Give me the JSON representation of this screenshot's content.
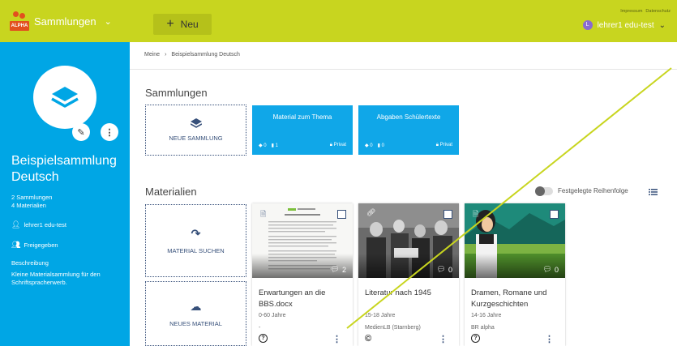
{
  "app": {
    "logo_text": "ALPHA",
    "title": "Sammlungen",
    "new_button": "Neu",
    "links": [
      "Impressum",
      "Datenschutz"
    ],
    "user_name": "lehrer1 edu-test",
    "user_initial": "L"
  },
  "sidebar": {
    "title": "Beispielsammlung Deutsch",
    "counts": [
      "2 Sammlungen",
      "4 Materialien"
    ],
    "owner": "lehrer1 edu-test",
    "shared": "Freigegeben",
    "desc_label": "Beschreibung",
    "description": "Kleine Materialsammlung für den Schriftspracherwerb."
  },
  "breadcrumb": [
    "Meine",
    "Beispielsammlung Deutsch"
  ],
  "collections": {
    "heading": "Sammlungen",
    "new_label": "NEUE SAMMLUNG",
    "items": [
      {
        "title": "Material zum Thema",
        "collections": "0",
        "materials": "1",
        "visibility": "Privat"
      },
      {
        "title": "Abgaben Schülertexte",
        "collections": "0",
        "materials": "0",
        "visibility": "Privat"
      }
    ]
  },
  "materials": {
    "heading": "Materialien",
    "order_label": "Festgelegte Reihenfolge",
    "search_label": "MATERIAL SUCHEN",
    "new_label": "NEUES MATERIAL",
    "items": [
      {
        "title": "Erwartungen an die BBS.docx",
        "age": "0-60 Jahre",
        "source": "-",
        "comments": "2",
        "license": "?"
      },
      {
        "title": "Literatur nach 1945",
        "age": "15-18 Jahre",
        "source": "MedienLB (Starnberg)",
        "comments": "0",
        "license": "©"
      },
      {
        "title": "Dramen, Romane und Kurzgeschichten",
        "age": "14-16 Jahre",
        "source": "BR alpha",
        "comments": "0",
        "license": "?"
      }
    ]
  },
  "colors": {
    "topbar": "#c8d51f",
    "sidebar": "#00a6e5",
    "card": "#10a7e8",
    "accent": "#37507a"
  }
}
